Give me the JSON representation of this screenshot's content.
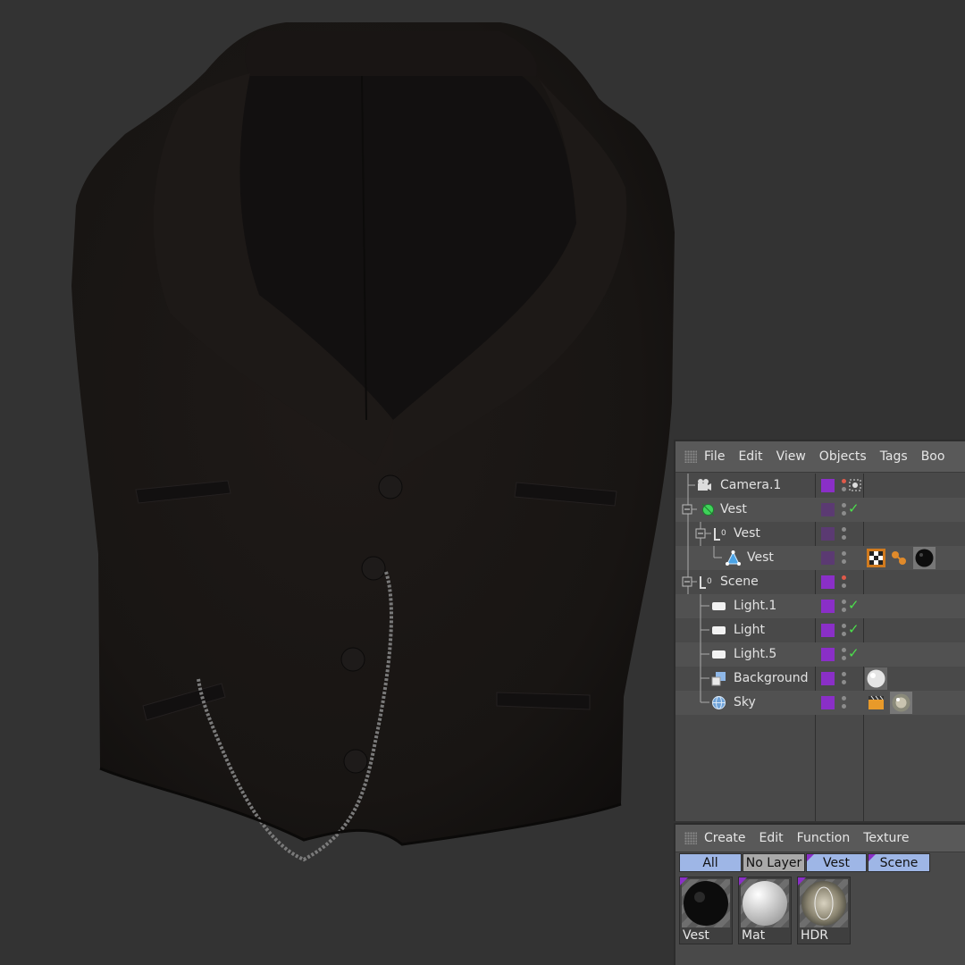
{
  "object_manager": {
    "menu": [
      "File",
      "Edit",
      "View",
      "Objects",
      "Tags",
      "Boo"
    ],
    "rows": [
      {
        "name": "Camera.1",
        "icon": "camera-icon",
        "depth": 0
      },
      {
        "name": "Vest",
        "icon": "null-green-icon",
        "depth": 0
      },
      {
        "name": "Vest",
        "icon": "lod-icon",
        "depth": 1
      },
      {
        "name": "Vest",
        "icon": "polygon-icon",
        "depth": 2
      },
      {
        "name": "Scene",
        "icon": "lod-icon",
        "depth": 0
      },
      {
        "name": "Light.1",
        "icon": "light-icon",
        "depth": 1
      },
      {
        "name": "Light",
        "icon": "light-icon",
        "depth": 1
      },
      {
        "name": "Light.5",
        "icon": "light-icon",
        "depth": 1
      },
      {
        "name": "Background",
        "icon": "background-icon",
        "depth": 1
      },
      {
        "name": "Sky",
        "icon": "sky-icon",
        "depth": 1
      }
    ]
  },
  "material_manager": {
    "menu": [
      "Create",
      "Edit",
      "Function",
      "Texture"
    ],
    "filters": [
      "All",
      "No Layer",
      "Vest",
      "Scene"
    ],
    "materials": [
      "Vest",
      "Mat",
      "HDR"
    ]
  },
  "colors": {
    "layer_purple": "#8a2fc7",
    "filter_blue": "#9eb6e6",
    "check_green": "#4ce04c",
    "panel_bg": "#494949",
    "viewport_bg": "#333333"
  }
}
